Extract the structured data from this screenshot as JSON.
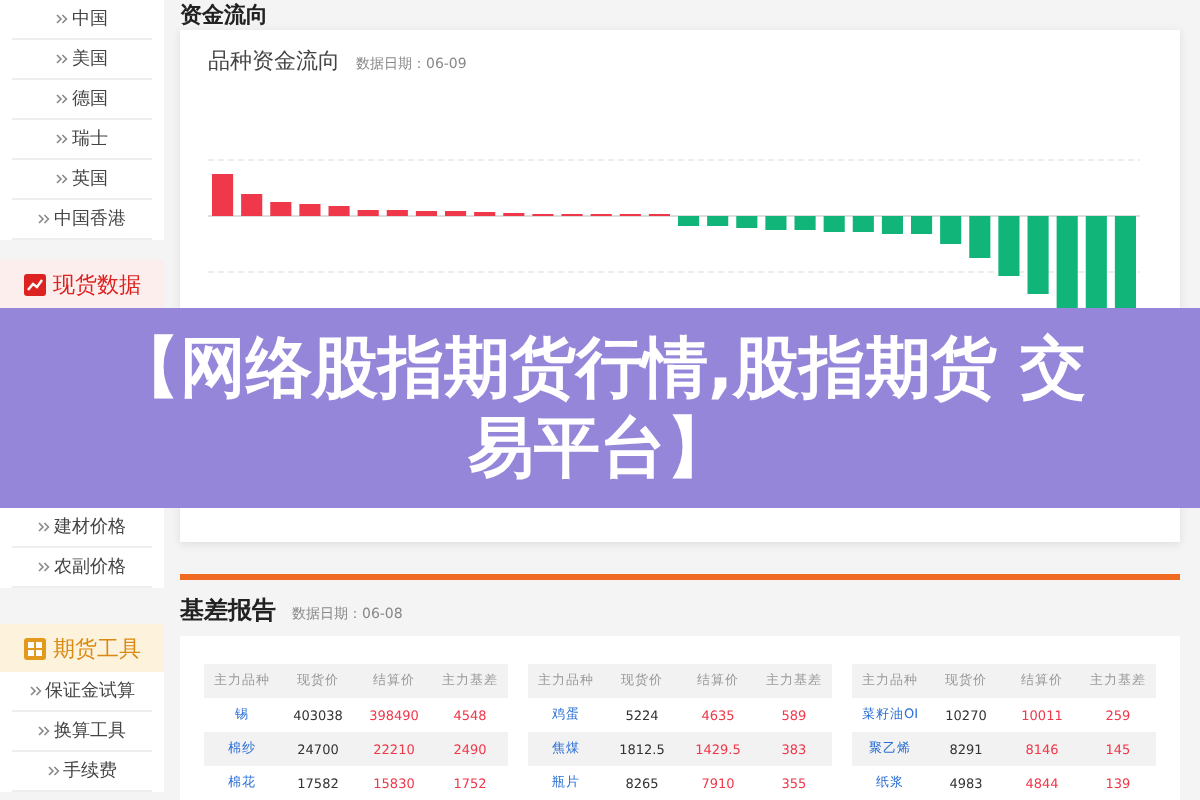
{
  "sidebar": {
    "regions": [
      {
        "label": "中国"
      },
      {
        "label": "美国"
      },
      {
        "label": "德国"
      },
      {
        "label": "瑞士"
      },
      {
        "label": "英国"
      },
      {
        "label": "中国香港"
      }
    ],
    "sections": [
      {
        "kind": "spot",
        "title": "现货数据",
        "items": [
          "建材价格",
          "农副价格"
        ]
      },
      {
        "kind": "tools",
        "title": "期货工具",
        "items": [
          "保证金试算",
          "换算工具",
          "手续费"
        ]
      }
    ]
  },
  "fund_flow": {
    "heading": "资金流向",
    "title": "品种资金流向",
    "date": "数据日期：06-09"
  },
  "banner": {
    "text": "【网络股指期货行情,股指期货 交易平台】"
  },
  "basis": {
    "title": "基差报告",
    "date": "数据日期：06-08",
    "tables": [
      {
        "columns": [
          "主力品种",
          "现货价",
          "结算价",
          "主力基差"
        ],
        "rows": [
          [
            "锡",
            "403038",
            "398490",
            "4548"
          ],
          [
            "棉纱",
            "24700",
            "22210",
            "2490"
          ],
          [
            "棉花",
            "17582",
            "15830",
            "1752"
          ]
        ]
      },
      {
        "columns": [
          "主力品种",
          "现货价",
          "结算价",
          "主力基差"
        ],
        "rows": [
          [
            "鸡蛋",
            "5224",
            "4635",
            "589"
          ],
          [
            "焦煤",
            "1812.5",
            "1429.5",
            "383"
          ],
          [
            "瓶片",
            "8265",
            "7910",
            "355"
          ]
        ]
      },
      {
        "columns": [
          "主力品种",
          "现货价",
          "结算价",
          "主力基差"
        ],
        "rows": [
          [
            "菜籽油OI",
            "10270",
            "10011",
            "259"
          ],
          [
            "聚乙烯",
            "8291",
            "8146",
            "145"
          ],
          [
            "纸浆",
            "4983",
            "4844",
            "139"
          ]
        ]
      }
    ]
  }
}
